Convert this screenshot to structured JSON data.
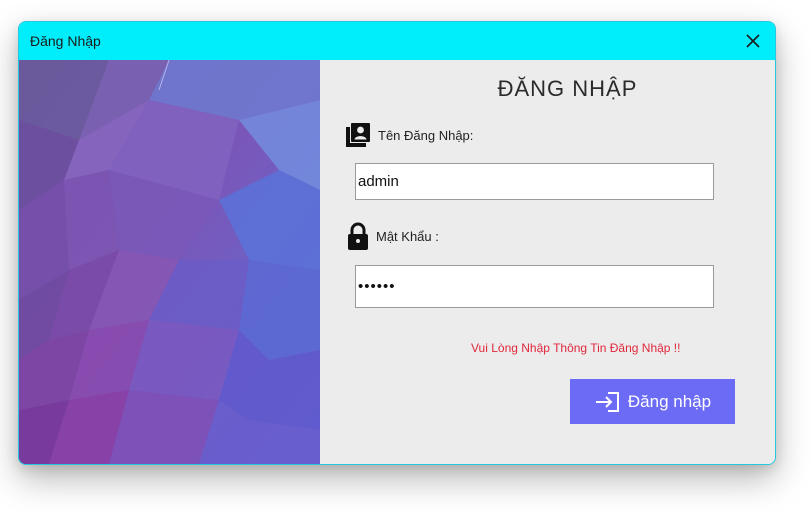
{
  "window": {
    "title": "Đăng Nhập"
  },
  "form": {
    "heading": "ĐĂNG NHẬP",
    "username_label": "Tên Đăng Nhập:",
    "username_value": "admin",
    "password_label": "Mật Khẩu :",
    "password_value": "••••••",
    "error_message": "Vui Lòng Nhập Thông Tin Đăng Nhập !!",
    "login_label": "Đăng nhập"
  },
  "icons": {
    "close": "close-icon",
    "user": "contacts-user-icon",
    "lock": "lock-icon",
    "login": "login-arrow-icon"
  },
  "colors": {
    "titlebar": "#00eefc",
    "button": "#6b6bf6",
    "error": "#e0283c",
    "panel": "#ececec"
  }
}
